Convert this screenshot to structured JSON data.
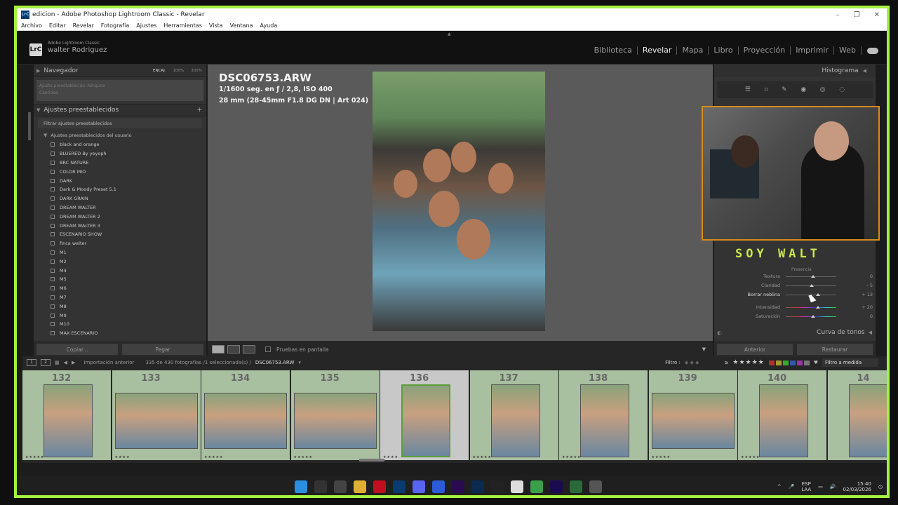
{
  "window": {
    "title": "edicion - Adobe Photoshop Lightroom Classic - Revelar",
    "app_icon": "LrC"
  },
  "menu": [
    "Archivo",
    "Editar",
    "Revelar",
    "Fotografía",
    "Ajustes",
    "Herramientas",
    "Vista",
    "Ventana",
    "Ayuda"
  ],
  "identity": {
    "product": "Adobe Lightroom Classic",
    "user": "walter Rodriguez",
    "logo": "LrC"
  },
  "modules": [
    "Biblioteca",
    "Revelar",
    "Mapa",
    "Libro",
    "Proyección",
    "Imprimir",
    "Web"
  ],
  "active_module": "Revelar",
  "navigator": {
    "title": "Navegador",
    "zoom_options": [
      "ENCAJ.",
      "100%",
      "300%"
    ],
    "stub_line1": "Ajuste preestablecido: Ninguno",
    "stub_line2": "Cantidad"
  },
  "presets": {
    "title": "Ajustes preestablecidos",
    "filter": "Filtrar ajustes preestablecidos",
    "folder": "Ajustes preestablecidos del usuario",
    "items": [
      "black and orange",
      "BLUERED By yeyoph",
      "BRC NATURE",
      "COLOR MIO",
      "DARK",
      "Dark & Moody Preset 5.1",
      "DARK GRAIN",
      "DREAM WALTER",
      "DREAM WALTER 2",
      "DREAM WALTER 3",
      "ESCENARIO SHOW",
      "finca walter",
      "M1",
      "M2",
      "M4",
      "M5",
      "M6",
      "M7",
      "M8",
      "M9",
      "M10",
      "MAX ESCENARIO"
    ]
  },
  "left_buttons": {
    "copy": "Copiar...",
    "paste": "Pegar"
  },
  "photo": {
    "filename": "DSC06753.ARW",
    "exposure": "1/1600 seg. en ƒ / 2,8, ISO 400",
    "lens": "28 mm (28-45mm F1.8 DG DN | Art 024)"
  },
  "center_toolbar": {
    "soft_proof": "Pruebas en pantalla"
  },
  "right": {
    "histogram": "Histograma",
    "overlay_text": "SOY WALT",
    "presence": "Presencia",
    "sliders": [
      {
        "label": "Textura",
        "value": "0",
        "pos": 0.5
      },
      {
        "label": "Claridad",
        "value": "– 5",
        "pos": 0.47
      },
      {
        "label": "Borrar neblina",
        "value": "+ 13",
        "pos": 0.6
      },
      {
        "label": "Intensidad",
        "value": "+ 20",
        "pos": 0.6
      },
      {
        "label": "Saturación",
        "value": "0",
        "pos": 0.5
      }
    ],
    "tone_curve": "Curva de tonos",
    "previous": "Anterior",
    "reset": "Restaurar"
  },
  "filmstrip_bar": {
    "view1": "1",
    "view2": "2",
    "source": "Importación anterior",
    "count": "335 de 430 fotografías /1 seleccionada(s) /",
    "path": "DSC06753.ARW",
    "filter_label": "Filtro :",
    "rating_op": "≥",
    "stars": "★★★★★",
    "filter_mode": "Filtro a medida"
  },
  "filmstrip": [
    {
      "num": "132",
      "stars": "★★★★★",
      "orient": "portrait"
    },
    {
      "num": "133",
      "stars": "★★★★",
      "orient": "landscape"
    },
    {
      "num": "134",
      "stars": "★★★★★",
      "orient": "landscape"
    },
    {
      "num": "135",
      "stars": "★★★★★",
      "orient": "landscape"
    },
    {
      "num": "136",
      "stars": "★★★★",
      "orient": "portrait"
    },
    {
      "num": "137",
      "stars": "★★★★★",
      "orient": "portrait"
    },
    {
      "num": "138",
      "stars": "★★★★★",
      "orient": "portrait"
    },
    {
      "num": "139",
      "stars": "★★★★★",
      "orient": "landscape"
    },
    {
      "num": "140",
      "stars": "★★★★★",
      "orient": "portrait"
    },
    {
      "num": "14",
      "stars": "",
      "orient": "portrait"
    }
  ],
  "selected_index": 4,
  "taskbar": {
    "icons": [
      "windows-start",
      "search",
      "task-view",
      "file-explorer",
      "opera",
      "lightroom",
      "discord",
      "word",
      "premiere",
      "photoshop",
      "capcut",
      "notepad",
      "chrome",
      "after-effects",
      "app",
      "settings"
    ],
    "lang1": "ESP",
    "lang2": "LAA",
    "time": "15:40",
    "date": "02/03/2026"
  },
  "colors": {
    "accent_border": "#a6f040",
    "webcam_border": "#d98a1a",
    "overlay_text": "#cbe94a",
    "filmstrip_cell": "#a8bfa0",
    "selected_cell": "#c8c8c8"
  }
}
